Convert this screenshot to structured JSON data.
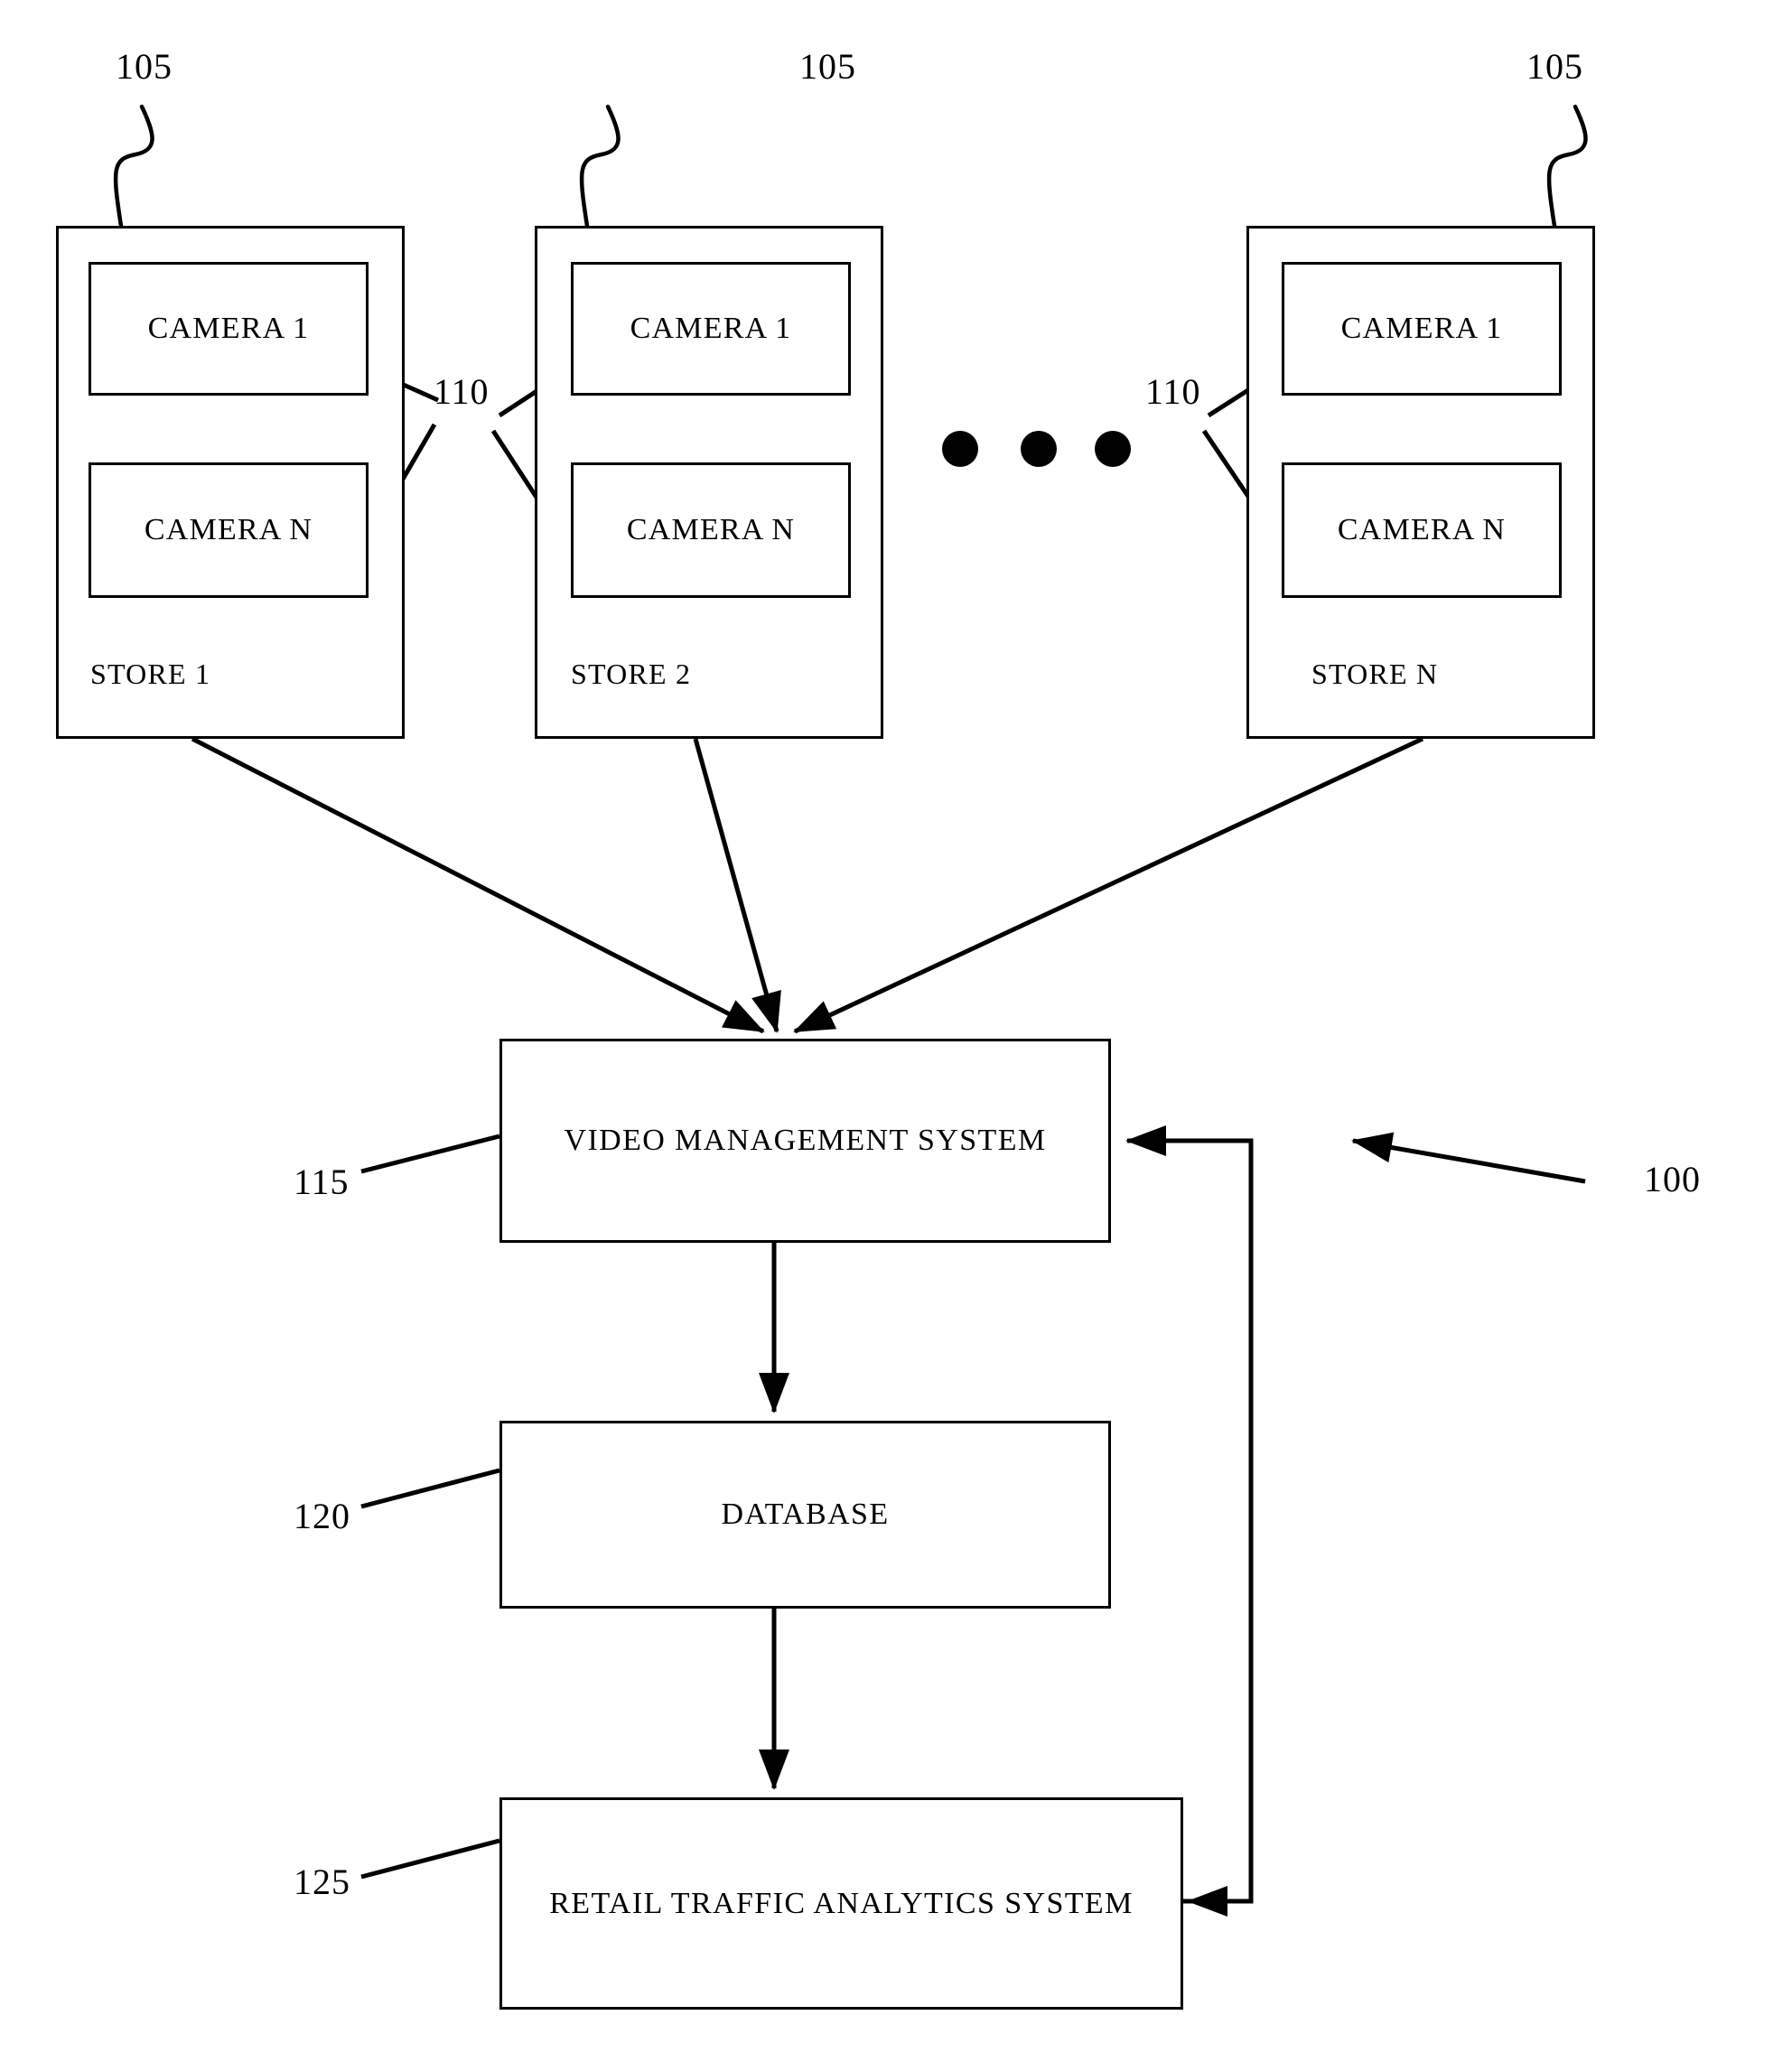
{
  "figure": {
    "type": "patent-block-diagram",
    "system_reference": "100",
    "background": "#ffffff",
    "line_color": "#000000"
  },
  "reference_numerals": {
    "store": "105",
    "camera": "110",
    "vms": "115",
    "database": "120",
    "analytics": "125",
    "system": "100"
  },
  "stores": [
    {
      "id": "store-1",
      "label": "STORE 1",
      "ref": "105",
      "camera_ref": "110",
      "cameras": [
        {
          "label": "CAMERA 1"
        },
        {
          "label": "CAMERA  N"
        }
      ]
    },
    {
      "id": "store-2",
      "label": "STORE 2",
      "ref": "105",
      "camera_ref": "110",
      "cameras": [
        {
          "label": "CAMERA 1"
        },
        {
          "label": "CAMERA  N"
        }
      ]
    },
    {
      "id": "store-n",
      "label": "STORE N",
      "ref": "105",
      "camera_ref": "110",
      "cameras": [
        {
          "label": "CAMERA 1"
        },
        {
          "label": "CAMERA  N"
        }
      ]
    }
  ],
  "ellipsis": {
    "name": "horizontal-ellipsis",
    "dots": 3
  },
  "blocks": [
    {
      "id": "vms",
      "label": "VIDEO MANAGEMENT SYSTEM",
      "ref": "115"
    },
    {
      "id": "database",
      "label": "DATABASE",
      "ref": "120"
    },
    {
      "id": "analytics",
      "label": "RETAIL TRAFFIC ANALYTICS SYSTEM",
      "ref": "125"
    }
  ],
  "connections": [
    {
      "from": "store-1",
      "to": "vms",
      "style": "arrow"
    },
    {
      "from": "store-2",
      "to": "vms",
      "style": "arrow"
    },
    {
      "from": "store-n",
      "to": "vms",
      "style": "arrow"
    },
    {
      "from": "vms",
      "to": "database",
      "style": "arrow"
    },
    {
      "from": "database",
      "to": "analytics",
      "style": "arrow"
    },
    {
      "from": "analytics",
      "to": "vms",
      "style": "feedback-arrow"
    }
  ]
}
